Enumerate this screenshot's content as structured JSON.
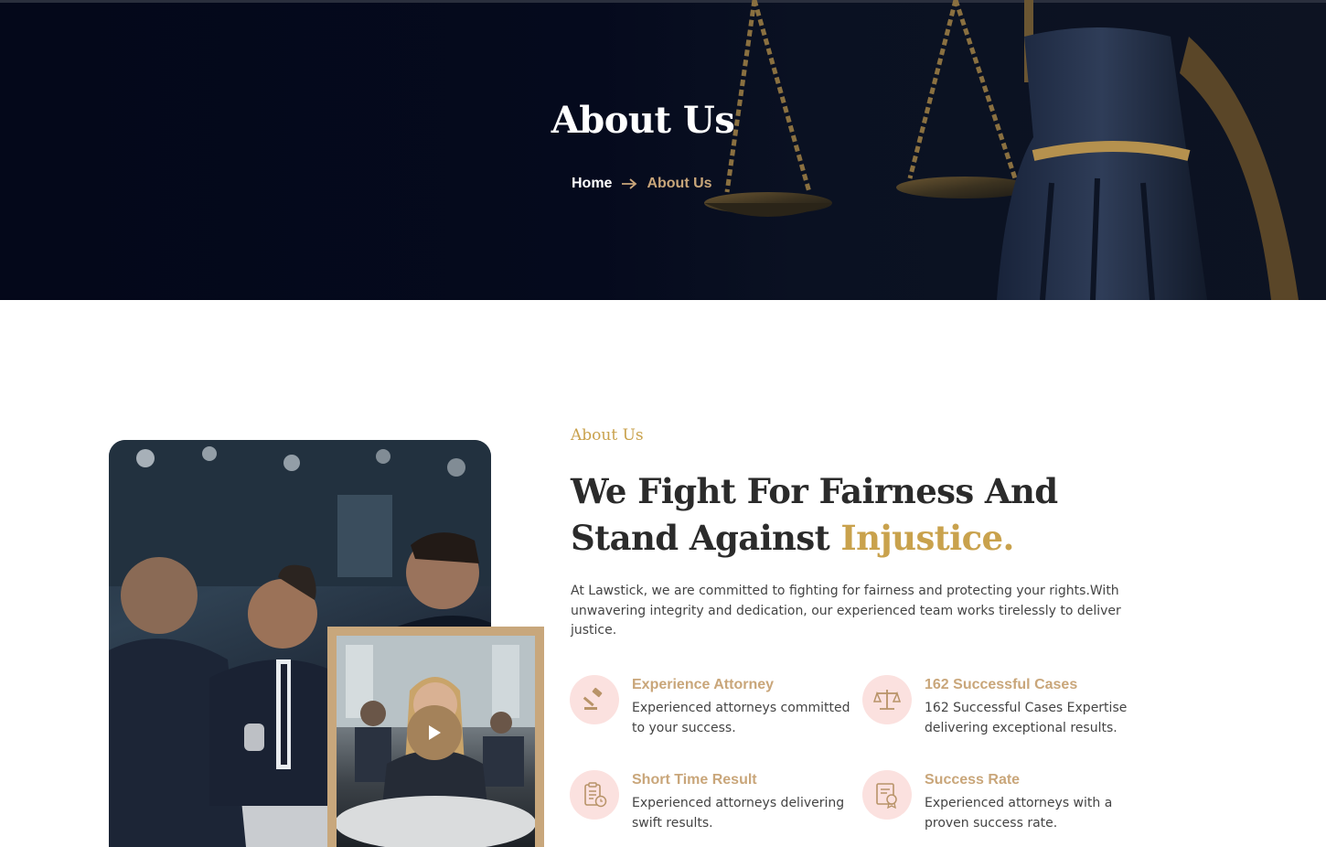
{
  "hero": {
    "title": "About Us",
    "breadcrumb": {
      "home": "Home",
      "separator_icon": "arrow-right-icon",
      "current": "About Us"
    },
    "background_icon": "scales-of-justice-statue"
  },
  "about": {
    "eyebrow": "About Us",
    "heading_main": "We Fight For Fairness And Stand Against ",
    "heading_accent": "Injustice.",
    "intro": "At Lawstick, we are committed to fighting for fairness and protecting your rights.With unwavering integrity and dedication, our experienced team works tirelessly to deliver justice.",
    "video_icon": "play-icon",
    "features": [
      {
        "icon": "gavel-icon",
        "title": "Experience Attorney",
        "desc": "Experienced attorneys committed to your success."
      },
      {
        "icon": "scales-icon",
        "title": "162 Successful Cases",
        "desc": "162 Successful Cases Expertise delivering exceptional results."
      },
      {
        "icon": "clipboard-clock-icon",
        "title": "Short Time Result",
        "desc": "Experienced attorneys delivering swift results."
      },
      {
        "icon": "certificate-icon",
        "title": "Success Rate",
        "desc": "Experienced attorneys with a proven success rate."
      }
    ]
  },
  "colors": {
    "hero_bg": "#04081a",
    "gold_accent": "#c9a24d",
    "tan_accent": "#c9a67a",
    "icon_circle": "#fbe1df",
    "text_dark": "#2b2b2b"
  }
}
